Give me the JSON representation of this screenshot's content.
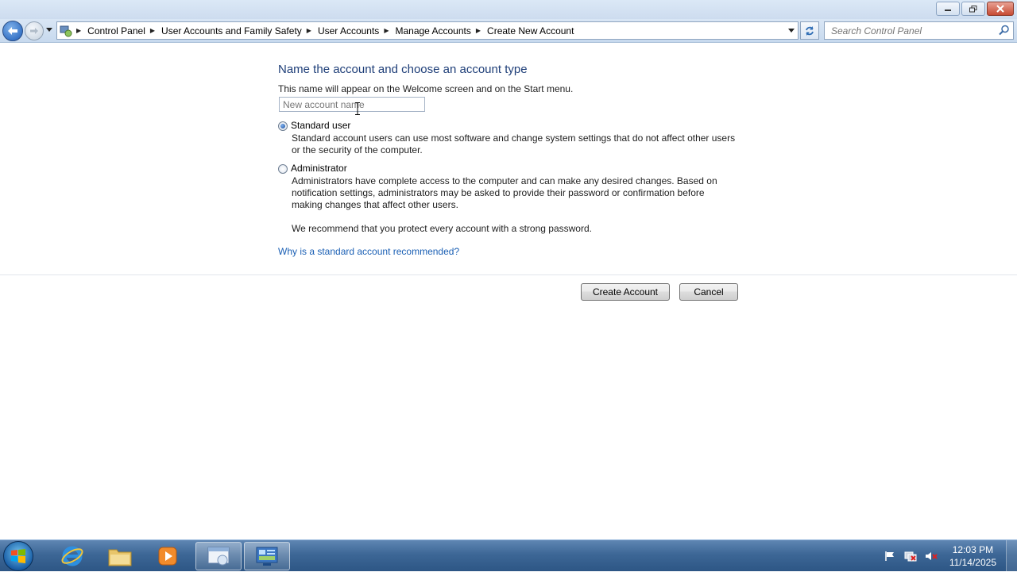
{
  "breadcrumb": [
    "Control Panel",
    "User Accounts and Family Safety",
    "User Accounts",
    "Manage Accounts",
    "Create New Account"
  ],
  "search": {
    "placeholder": "Search Control Panel"
  },
  "page": {
    "heading": "Name the account and choose an account type",
    "subtext": "This name will appear on the Welcome screen and on the Start menu.",
    "name_placeholder": "New account name"
  },
  "options": {
    "standard": {
      "label": "Standard user",
      "description": "Standard account users can use most software and change system settings that do not affect other users or the security of the computer.",
      "checked": true
    },
    "admin": {
      "label": "Administrator",
      "description": "Administrators have complete access to the computer and can make any desired changes. Based on notification settings, administrators may be asked to provide their password or confirmation before making changes that affect other users.",
      "recommendation": "We recommend that you protect every account with a strong password.",
      "checked": false
    }
  },
  "help_link": "Why is a standard account recommended?",
  "buttons": {
    "create": "Create Account",
    "cancel": "Cancel"
  },
  "taskbar": {
    "pinned": [
      "internet-explorer-icon",
      "folder-icon",
      "media-player-icon",
      "window-icon",
      "control-panel-icon"
    ],
    "clock": {
      "time": "12:03 PM",
      "date": "11/14/2025"
    }
  }
}
